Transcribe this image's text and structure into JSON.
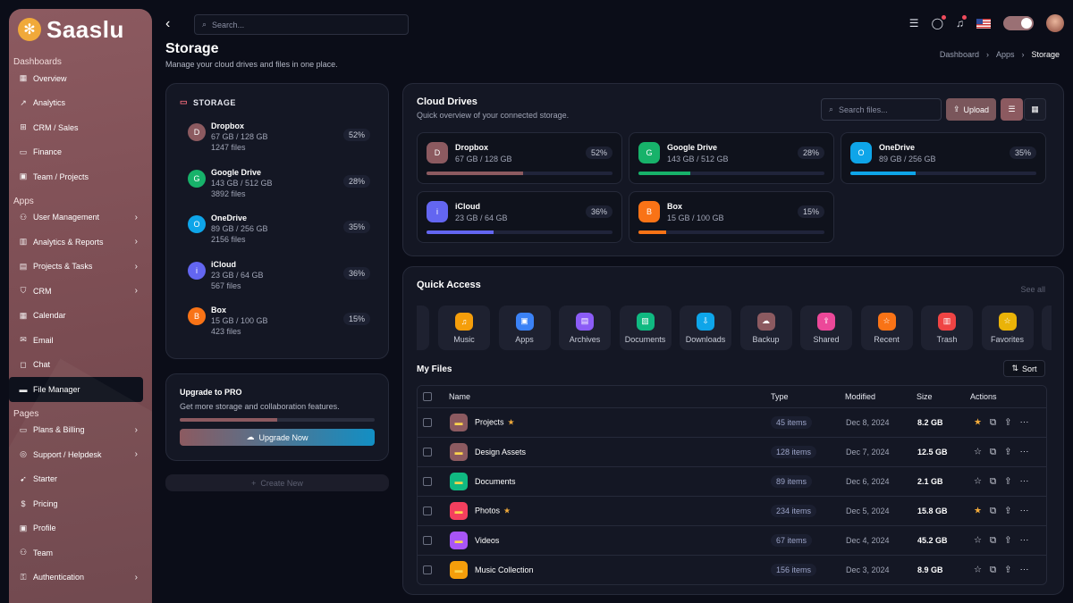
{
  "brand": {
    "name": "Saaslu",
    "logo_icon": "✻"
  },
  "sidebar": {
    "sections": [
      {
        "title": "Dashboards",
        "items": [
          {
            "label": "Overview",
            "icon": "▦",
            "chev": false
          },
          {
            "label": "Analytics",
            "icon": "↗",
            "chev": false
          },
          {
            "label": "CRM / Sales",
            "icon": "⊞",
            "chev": false
          },
          {
            "label": "Finance",
            "icon": "▭",
            "chev": false
          },
          {
            "label": "Team / Projects",
            "icon": "▣",
            "chev": false
          }
        ]
      },
      {
        "title": "Apps",
        "items": [
          {
            "label": "User Management",
            "icon": "⚇",
            "chev": true
          },
          {
            "label": "Analytics & Reports",
            "icon": "▥",
            "chev": true
          },
          {
            "label": "Projects & Tasks",
            "icon": "▤",
            "chev": true
          },
          {
            "label": "CRM",
            "icon": "⛉",
            "chev": true
          },
          {
            "label": "Calendar",
            "icon": "▦",
            "chev": false
          },
          {
            "label": "Email",
            "icon": "✉",
            "chev": false
          },
          {
            "label": "Chat",
            "icon": "◻",
            "chev": false
          },
          {
            "label": "File Manager",
            "icon": "▬",
            "chev": false,
            "active": true
          }
        ]
      },
      {
        "title": "Pages",
        "items": [
          {
            "label": "Plans & Billing",
            "icon": "▭",
            "chev": true
          },
          {
            "label": "Support / Helpdesk",
            "icon": "◎",
            "chev": true
          },
          {
            "label": "Starter",
            "icon": "➹",
            "chev": false
          },
          {
            "label": "Pricing",
            "icon": "$",
            "chev": false
          },
          {
            "label": "Profile",
            "icon": "▣",
            "chev": false
          },
          {
            "label": "Team",
            "icon": "⚇",
            "chev": false
          },
          {
            "label": "Authentication",
            "icon": "⚿",
            "chev": true
          }
        ]
      }
    ]
  },
  "topbar": {
    "search_placeholder": "Search..."
  },
  "page": {
    "title": "Storage",
    "subtitle": "Manage your cloud drives and files in one place."
  },
  "breadcrumb": [
    "Dashboard",
    "Apps",
    "Storage"
  ],
  "storage": {
    "title": "STORAGE",
    "items": [
      {
        "letter": "D",
        "name": "Dropbox",
        "size": "67 GB / 128 GB",
        "files": "1247 files",
        "pct": "52%",
        "color": "#8c5a60"
      },
      {
        "letter": "G",
        "name": "Google Drive",
        "size": "143 GB / 512 GB",
        "files": "3892 files",
        "pct": "28%",
        "color": "#17b26a"
      },
      {
        "letter": "O",
        "name": "OneDrive",
        "size": "89 GB / 256 GB",
        "files": "2156 files",
        "pct": "35%",
        "color": "#0ea5e9"
      },
      {
        "letter": "i",
        "name": "iCloud",
        "size": "23 GB / 64 GB",
        "files": "567 files",
        "pct": "36%",
        "color": "#6366f1"
      },
      {
        "letter": "B",
        "name": "Box",
        "size": "15 GB / 100 GB",
        "files": "423 files",
        "pct": "15%",
        "color": "#f97316"
      }
    ]
  },
  "upgrade": {
    "title": "Upgrade to PRO",
    "subtitle": "Get more storage and collaboration features.",
    "button": "Upgrade Now",
    "progress": 0.5
  },
  "create_new": "Create New",
  "cloud_drives": {
    "title": "Cloud Drives",
    "subtitle": "Quick overview of your connected storage.",
    "search_placeholder": "Search files...",
    "upload_label": "Upload",
    "drives": [
      {
        "letter": "D",
        "name": "Dropbox",
        "size": "67 GB / 128 GB",
        "pct": "52%",
        "fill": 0.52,
        "color": "#8c5a60"
      },
      {
        "letter": "G",
        "name": "Google Drive",
        "size": "143 GB / 512 GB",
        "pct": "28%",
        "fill": 0.28,
        "color": "#17b26a"
      },
      {
        "letter": "O",
        "name": "OneDrive",
        "size": "89 GB / 256 GB",
        "pct": "35%",
        "fill": 0.35,
        "color": "#0ea5e9"
      },
      {
        "letter": "i",
        "name": "iCloud",
        "size": "23 GB / 64 GB",
        "pct": "36%",
        "fill": 0.36,
        "color": "#6366f1"
      },
      {
        "letter": "B",
        "name": "Box",
        "size": "15 GB / 100 GB",
        "pct": "15%",
        "fill": 0.15,
        "color": "#f97316"
      }
    ]
  },
  "quick_access": {
    "title": "Quick Access",
    "see_all": "See all",
    "items": [
      {
        "label": "Music",
        "icon": "♫",
        "color": "#f59e0b"
      },
      {
        "label": "Apps",
        "icon": "▣",
        "color": "#3b82f6"
      },
      {
        "label": "Archives",
        "icon": "▤",
        "color": "#8b5cf6"
      },
      {
        "label": "Documents",
        "icon": "▧",
        "color": "#10b981"
      },
      {
        "label": "Downloads",
        "icon": "⇩",
        "color": "#0ea5e9"
      },
      {
        "label": "Backup",
        "icon": "☁",
        "color": "#8c5a60"
      },
      {
        "label": "Shared",
        "icon": "⇪",
        "color": "#ec4899"
      },
      {
        "label": "Recent",
        "icon": "☆",
        "color": "#f97316"
      },
      {
        "label": "Trash",
        "icon": "▥",
        "color": "#ef4444"
      },
      {
        "label": "Favorites",
        "icon": "☆",
        "color": "#eab308"
      }
    ]
  },
  "my_files": {
    "title": "My Files",
    "sort_label": "Sort",
    "columns": [
      "Name",
      "Type",
      "Modified",
      "Size",
      "Actions"
    ],
    "rows": [
      {
        "name": "Projects",
        "starred": true,
        "items": "45 items",
        "modified": "Dec 8, 2024",
        "size": "8.2 GB",
        "color": "#8c5a60"
      },
      {
        "name": "Design Assets",
        "starred": false,
        "items": "128 items",
        "modified": "Dec 7, 2024",
        "size": "12.5 GB",
        "color": "#8c5a60"
      },
      {
        "name": "Documents",
        "starred": false,
        "items": "89 items",
        "modified": "Dec 6, 2024",
        "size": "2.1 GB",
        "color": "#10b981"
      },
      {
        "name": "Photos",
        "starred": true,
        "items": "234 items",
        "modified": "Dec 5, 2024",
        "size": "15.8 GB",
        "color": "#f43f5e"
      },
      {
        "name": "Videos",
        "starred": false,
        "items": "67 items",
        "modified": "Dec 4, 2024",
        "size": "45.2 GB",
        "color": "#a855f7"
      },
      {
        "name": "Music Collection",
        "starred": false,
        "items": "156 items",
        "modified": "Dec 3, 2024",
        "size": "8.9 GB",
        "color": "#f59e0b"
      }
    ]
  }
}
